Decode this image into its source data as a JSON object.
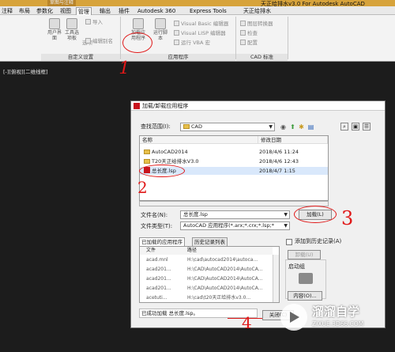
{
  "window": {
    "title": "天正给排水v3.0 For Autodesk AutoCAD",
    "quick_access": "草图与注释"
  },
  "menu_tabs": [
    "注释",
    "布局",
    "参数化",
    "视图",
    "管理",
    "输出",
    "插件",
    "Autodesk 360",
    "Express Tools",
    "天正给排水"
  ],
  "menu_active": "管理",
  "ribbon": {
    "cuix": {
      "big_buttons": [
        "用户界面",
        "工具选项板"
      ],
      "extra_label": "选项",
      "small": [
        "导入",
        "编辑别名"
      ],
      "title": "自定义设置"
    },
    "app": {
      "big_buttons": [
        "加载应用程序",
        "运行脚本"
      ],
      "small": [
        "Visual Basic 编辑器",
        "Visual LISP 编辑器",
        "运行 VBA 宏"
      ],
      "title": "应用程序"
    },
    "cad_std": {
      "small": [
        "图层转换器",
        "检查",
        "配置"
      ],
      "title": "CAD 标准"
    }
  },
  "annotations": [
    "1",
    "2",
    "3",
    "4"
  ],
  "viewport_label": "[-][俯视][二维线框]",
  "dialog": {
    "title": "加载/卸载应用程序",
    "look_in_label": "查找范围(I):",
    "look_in_value": "CAD",
    "columns": [
      "名称",
      "修改日期"
    ],
    "files": [
      {
        "name": "AutoCAD2014",
        "date": "2018/4/6 11:24",
        "type": "folder"
      },
      {
        "name": "T20天正给排水V3.0",
        "date": "2018/4/6 12:43",
        "type": "folder"
      },
      {
        "name": "总长度.lsp",
        "date": "2018/4/7 1:15",
        "type": "lsp"
      }
    ],
    "filename_label": "文件名(N):",
    "filename_value": "总长度.lsp",
    "filetype_label": "文件类型(T):",
    "filetype_value": "AutoCAD 应用程序(*.arx;*.crx;*.lsp;*",
    "load_button": "加载(L)",
    "add_history_label": "添加到历史记录(A)",
    "tabs": [
      "已加载的应用程序",
      "历史记录列表"
    ],
    "apps_columns": [
      "文件",
      "路径"
    ],
    "apps": [
      {
        "file": "acad.mnl",
        "path": "H:\\cad\\autocad2014\\autoca..."
      },
      {
        "file": "acad201...",
        "path": "H:\\CAD\\AutoCAD2014\\AutoCA..."
      },
      {
        "file": "acad201...",
        "path": "H:\\CAD\\AutoCAD2014\\AutoCA..."
      },
      {
        "file": "acad201...",
        "path": "H:\\CAD\\AutoCAD2014\\AutoCA..."
      },
      {
        "file": "acetuti...",
        "path": "H:\\cad\\t20天正给排水v3.0..."
      }
    ],
    "unload_button": "卸载(U)",
    "startup_suite_label": "启动组",
    "contents_button": "内容(O)...",
    "status_text": "已成功加载 总长度.lsp。",
    "close_button": "关闭(C)"
  },
  "watermark": {
    "title": "溜溜自学",
    "url": "ZIXUE.3D66.COM"
  },
  "colors": {
    "accent": "#e01818",
    "title_bar": "#d7a33b",
    "dark_bg": "#1c1c1c"
  }
}
